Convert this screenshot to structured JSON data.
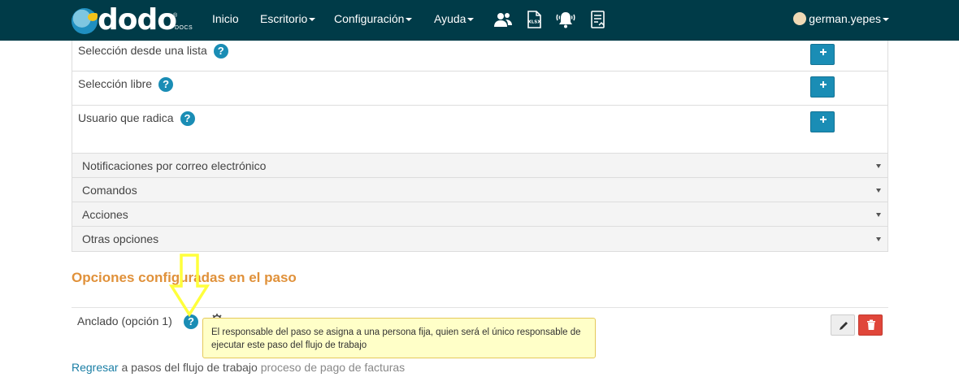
{
  "navbar": {
    "logo_text": "dodo",
    "logo_sub": "DOCS",
    "logo_reg": "®",
    "links": [
      {
        "label": "Inicio",
        "dropdown": false
      },
      {
        "label": "Escritorio",
        "dropdown": true
      },
      {
        "label": "Configuración",
        "dropdown": true
      },
      {
        "label": "Ayuda",
        "dropdown": true
      }
    ],
    "icons": [
      "users-icon",
      "xlsx-file-icon",
      "notification-bell-icon",
      "document-list-icon"
    ],
    "xlsx_label": "XLSX",
    "user": "german.yepes",
    "bg_color": "#003b48"
  },
  "list": {
    "rows": [
      {
        "label": "Selección desde una lista"
      },
      {
        "label": "Selección libre"
      },
      {
        "label": "Usuario que radica"
      }
    ],
    "help_glyph": "?"
  },
  "accordion": {
    "items": [
      {
        "label": "Notificaciones por correo electrónico"
      },
      {
        "label": "Comandos"
      },
      {
        "label": "Acciones"
      },
      {
        "label": "Otras opciones"
      }
    ]
  },
  "section": {
    "title": "Opciones configuradas en el paso",
    "title_color": "#e0913a",
    "option_label": "Anclado (opción 1)",
    "tooltip": "El responsable del paso se asigna a una persona fija, quien será el único responsable de ejecutar este paso del flujo de trabajo"
  },
  "footer": {
    "link": "Regresar",
    "text": " a pasos del flujo de trabajo ",
    "muted": "proceso de pago de facturas"
  },
  "colors": {
    "accent_blue": "#1a8db5",
    "delete_red": "#e0463a",
    "annotation_yellow": "#ffff3c"
  }
}
